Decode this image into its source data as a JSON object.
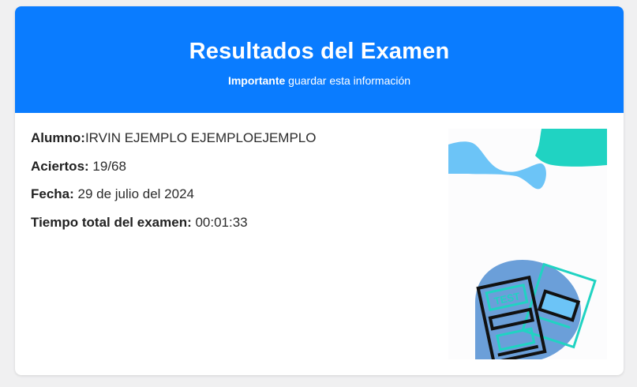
{
  "header": {
    "title": "Resultados del Examen",
    "subtitle_strong": "Importante",
    "subtitle_rest": " guardar esta información"
  },
  "results": {
    "alumno_label": "Alumno:",
    "alumno_value": "IRVIN EJEMPLO EJEMPLOEJEMPLO",
    "aciertos_label": "Aciertos:",
    "aciertos_value": " 19/68",
    "fecha_label": "Fecha:",
    "fecha_value": " 29 de julio del 2024",
    "tiempo_label": "Tiempo total del examen:",
    "tiempo_value": " 00:01:33"
  },
  "illustration": {
    "test_text": "TEST"
  },
  "colors": {
    "header_bg": "#0a7cff",
    "teal": "#20d3c2",
    "sky": "#6cc4f7",
    "blob_blue": "#6b9fd9"
  }
}
